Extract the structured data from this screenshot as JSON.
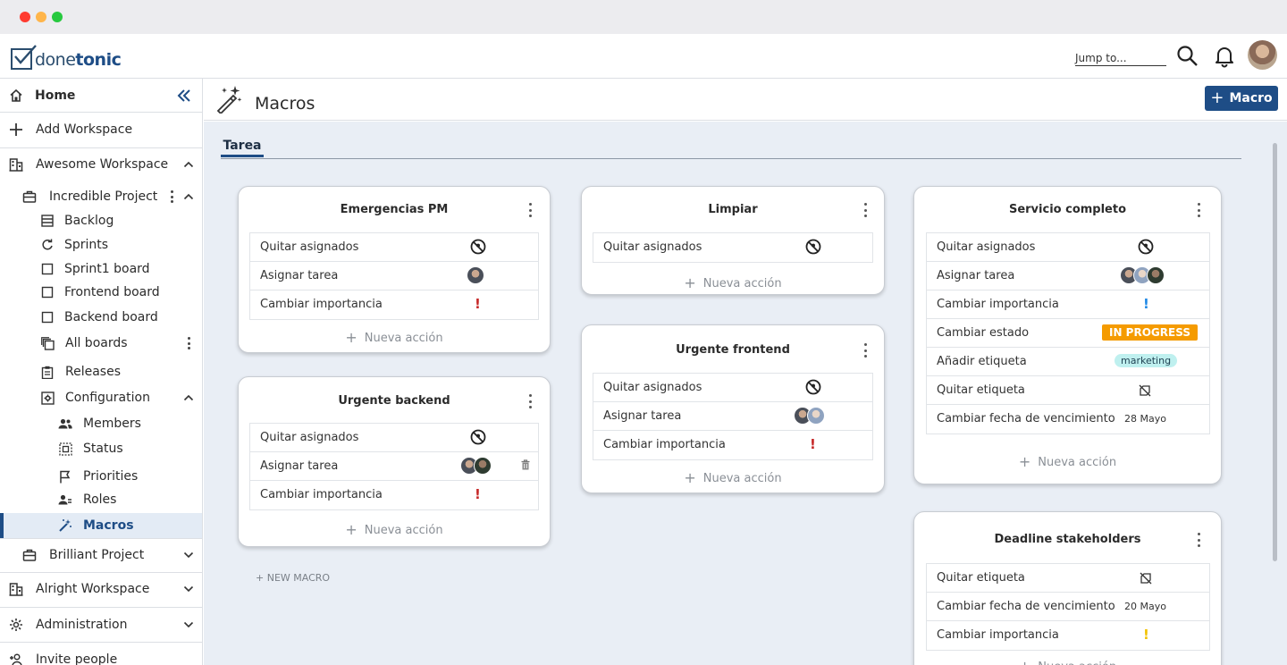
{
  "window": {
    "controls": [
      "close",
      "minimize",
      "maximize"
    ]
  },
  "header": {
    "logo_text_a": "done",
    "logo_text_b": "tonic",
    "jump_placeholder": "Jump to...",
    "icons": [
      "search-icon",
      "bell-icon",
      "user-avatar"
    ]
  },
  "sidebar": {
    "home": "Home",
    "add_workspace": "Add Workspace",
    "workspace": "Awesome Workspace",
    "project": "Incredible Project",
    "project_items": {
      "backlog": "Backlog",
      "sprints": "Sprints",
      "sprint1": "Sprint1 board",
      "frontend": "Frontend board",
      "backend": "Backend board",
      "all_boards": "All boards",
      "releases": "Releases",
      "configuration": "Configuration"
    },
    "config_items": {
      "members": "Members",
      "status": "Status",
      "priorities": "Priorities",
      "roles": "Roles",
      "macros": "Macros"
    },
    "brilliant": "Brilliant Project",
    "alright": "Alright Workspace",
    "administration": "Administration",
    "invite": "Invite people"
  },
  "page": {
    "title": "Macros",
    "new_macro_label": "Macro",
    "tab": "Tarea",
    "add_action": "Nueva acción",
    "new_macro_link": "+ NEW MACRO"
  },
  "colors": {
    "brand": "#1e4d86",
    "in_progress": "#f59b00",
    "tag": "#bff0ef",
    "importance_red": "#c62828",
    "importance_blue": "#1e88e5",
    "importance_yellow": "#f2c200"
  },
  "macros": {
    "emergencias": {
      "title": "Emergencias PM",
      "rows": [
        "Quitar asignados",
        "Asignar tarea",
        "Cambiar importancia"
      ]
    },
    "urgente_backend": {
      "title": "Urgente backend",
      "rows": [
        "Quitar asignados",
        "Asignar tarea",
        "Cambiar importancia"
      ]
    },
    "limpiar": {
      "title": "Limpiar",
      "rows": [
        "Quitar asignados"
      ]
    },
    "urgente_frontend": {
      "title": "Urgente frontend",
      "rows": [
        "Quitar asignados",
        "Asignar tarea",
        "Cambiar importancia"
      ]
    },
    "servicio": {
      "title": "Servicio completo",
      "rows": [
        "Quitar asignados",
        "Asignar tarea",
        "Cambiar importancia",
        "Cambiar estado",
        "Añadir etiqueta",
        "Quitar etiqueta",
        "Cambiar fecha de vencimiento"
      ],
      "status_badge": "IN PROGRESS",
      "tag": "marketing",
      "due_date": "28 Mayo"
    },
    "deadline": {
      "title": "Deadline stakeholders",
      "rows": [
        "Quitar etiqueta",
        "Cambiar fecha de vencimiento",
        "Cambiar importancia"
      ],
      "due_date": "20 Mayo"
    }
  }
}
